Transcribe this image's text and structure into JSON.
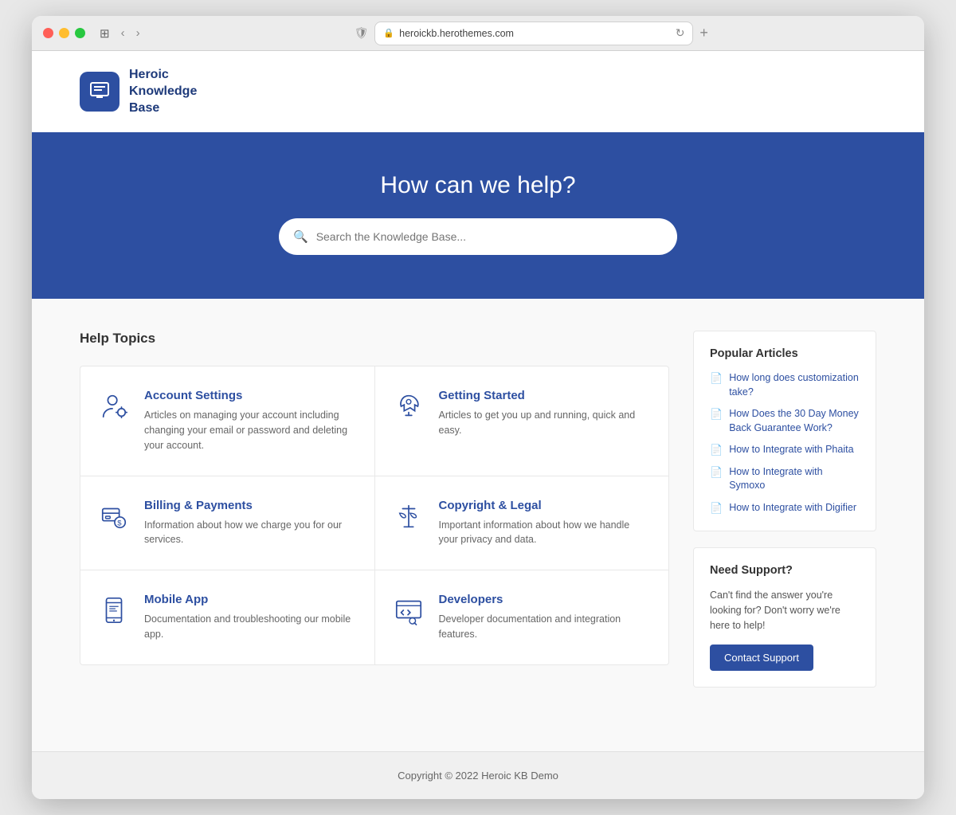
{
  "browser": {
    "url": "heroickb.herothemes.com",
    "tab_label": "heroickb.herothemes.com"
  },
  "header": {
    "logo_text": "Heroic Knowledge Base",
    "logo_lines": [
      "Heroic",
      "Knowledge",
      "Base"
    ]
  },
  "hero": {
    "title": "How can we help?",
    "search_placeholder": "Search the Knowledge Base..."
  },
  "help_topics": {
    "section_title": "Help Topics",
    "topics": [
      {
        "id": "account-settings",
        "name": "Account Settings",
        "desc": "Articles on managing your account including changing your email or password and deleting your account.",
        "icon": "person-settings"
      },
      {
        "id": "getting-started",
        "name": "Getting Started",
        "desc": "Articles to get you up and running, quick and easy.",
        "icon": "rocket"
      },
      {
        "id": "billing-payments",
        "name": "Billing & Payments",
        "desc": "Information about how we charge you for our services.",
        "icon": "billing"
      },
      {
        "id": "copyright-legal",
        "name": "Copyright & Legal",
        "desc": "Important information about how we handle your privacy and data.",
        "icon": "legal"
      },
      {
        "id": "mobile-app",
        "name": "Mobile App",
        "desc": "Documentation and troubleshooting our mobile app.",
        "icon": "mobile"
      },
      {
        "id": "developers",
        "name": "Developers",
        "desc": "Developer documentation and integration features.",
        "icon": "developers"
      }
    ]
  },
  "sidebar": {
    "popular_articles": {
      "title": "Popular Articles",
      "articles": [
        "How long does customization take?",
        "How Does the 30 Day Money Back Guarantee Work?",
        "How to Integrate with Phaita",
        "How to Integrate with Symoxo",
        "How to Integrate with Digifier"
      ]
    },
    "need_support": {
      "title": "Need Support?",
      "desc": "Can't find the answer you're looking for? Don't worry we're here to help!",
      "button_label": "Contact Support"
    }
  },
  "footer": {
    "copyright": "Copyright © 2022 Heroic KB Demo"
  }
}
